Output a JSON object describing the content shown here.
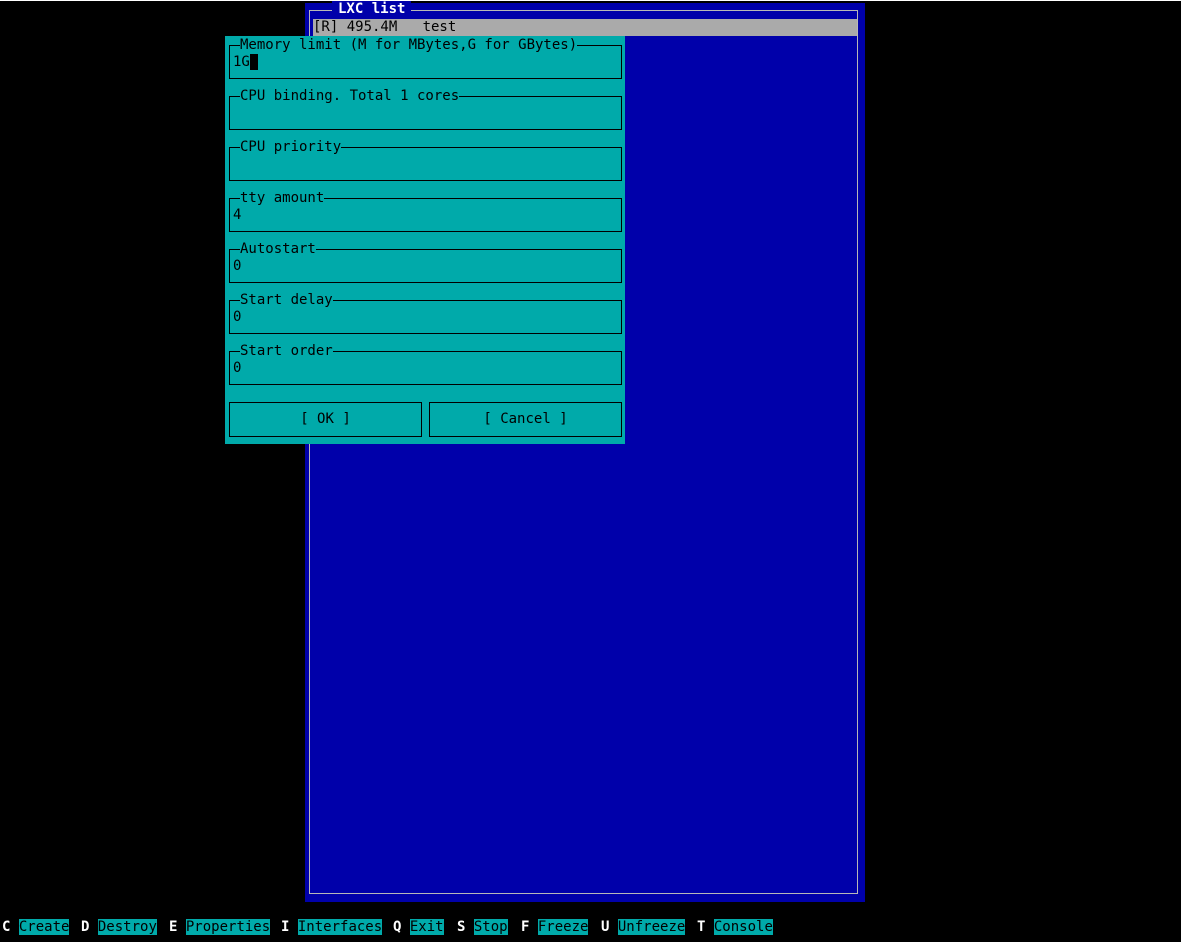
{
  "lxc_list": {
    "title": "LXC list",
    "rows": [
      {
        "text": "[R] 495.4M   test"
      }
    ]
  },
  "dialog": {
    "fields": [
      {
        "label": "Memory limit (M for MBytes,G for GBytes)",
        "value": "1G"
      },
      {
        "label": "CPU binding. Total 1 cores",
        "value": ""
      },
      {
        "label": "CPU priority",
        "value": ""
      },
      {
        "label": "tty amount",
        "value": "4"
      },
      {
        "label": "Autostart",
        "value": "0"
      },
      {
        "label": "Start delay",
        "value": "0"
      },
      {
        "label": "Start order",
        "value": "0"
      }
    ],
    "ok_label": "[ OK ]",
    "cancel_label": "[ Cancel ]"
  },
  "keybar": [
    {
      "key": "C",
      "label": "Create"
    },
    {
      "key": "D",
      "label": "Destroy"
    },
    {
      "key": "E",
      "label": "Properties"
    },
    {
      "key": "I",
      "label": "Interfaces"
    },
    {
      "key": "Q",
      "label": "Exit"
    },
    {
      "key": "S",
      "label": "Stop"
    },
    {
      "key": "F",
      "label": "Freeze"
    },
    {
      "key": "U",
      "label": "Unfreeze"
    },
    {
      "key": "T",
      "label": "Console"
    }
  ],
  "colors": {
    "screen_bg": "#000000",
    "list_bg": "#0000aa",
    "dialog_bg": "#00aaaa",
    "selection_bg": "#aaaaaa"
  }
}
